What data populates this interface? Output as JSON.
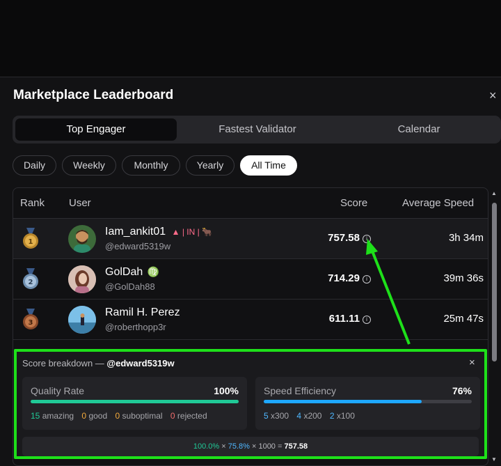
{
  "modal": {
    "title": "Marketplace Leaderboard",
    "close_label": "×"
  },
  "tabs": [
    {
      "label": "Top Engager",
      "active": true
    },
    {
      "label": "Fastest Validator",
      "active": false
    },
    {
      "label": "Calendar",
      "active": false
    }
  ],
  "filters": [
    {
      "label": "Daily",
      "active": false
    },
    {
      "label": "Weekly",
      "active": false
    },
    {
      "label": "Monthly",
      "active": false
    },
    {
      "label": "Yearly",
      "active": false
    },
    {
      "label": "All Time",
      "active": true
    }
  ],
  "table": {
    "headers": {
      "rank": "Rank",
      "user": "User",
      "score": "Score",
      "speed": "Average Speed"
    },
    "rows": [
      {
        "rank": 1,
        "medal": "gold-medal-icon",
        "name": "Iam_ankit01",
        "badges": "▲ | IN | 🐂",
        "handle": "@edward5319w",
        "score": "757.58",
        "speed": "3h 34m"
      },
      {
        "rank": 2,
        "medal": "silver-medal-icon",
        "name": "GolDah",
        "badges": "♍",
        "handle": "@GolDah88",
        "score": "714.29",
        "speed": "39m 36s"
      },
      {
        "rank": 3,
        "medal": "bronze-medal-icon",
        "name": "Ramil H. Perez",
        "badges": "",
        "handle": "@roberthopp3r",
        "score": "611.11",
        "speed": "25m 47s"
      }
    ]
  },
  "breakdown": {
    "title_prefix": "Score breakdown — ",
    "title_handle": "@edward5319w",
    "close_label": "×",
    "quality": {
      "label": "Quality Rate",
      "value": "100%",
      "fill_percent": 100,
      "color": "#20c997",
      "legend": [
        {
          "count": "15",
          "text": "amazing",
          "color": "#20c997"
        },
        {
          "count": "0",
          "text": "good",
          "color": "#f2a93b"
        },
        {
          "count": "0",
          "text": "suboptimal",
          "color": "#f2a93b"
        },
        {
          "count": "0",
          "text": "rejected",
          "color": "#ef6b6b"
        }
      ]
    },
    "speed": {
      "label": "Speed Efficiency",
      "value": "76%",
      "fill_percent": 76,
      "color": "#1ea7ff",
      "legend": [
        {
          "count": "5",
          "text": "x300",
          "color": "#4fb7ff"
        },
        {
          "count": "4",
          "text": "x200",
          "color": "#4fb7ff"
        },
        {
          "count": "2",
          "text": "x100",
          "color": "#4fb7ff"
        }
      ]
    },
    "formula": {
      "quality_pct": "100.0%",
      "times1": " × ",
      "speed_pct": "75.8%",
      "rest": " × 1000 = ",
      "result": "757.58"
    }
  },
  "annotation_color": "#1ee01a"
}
